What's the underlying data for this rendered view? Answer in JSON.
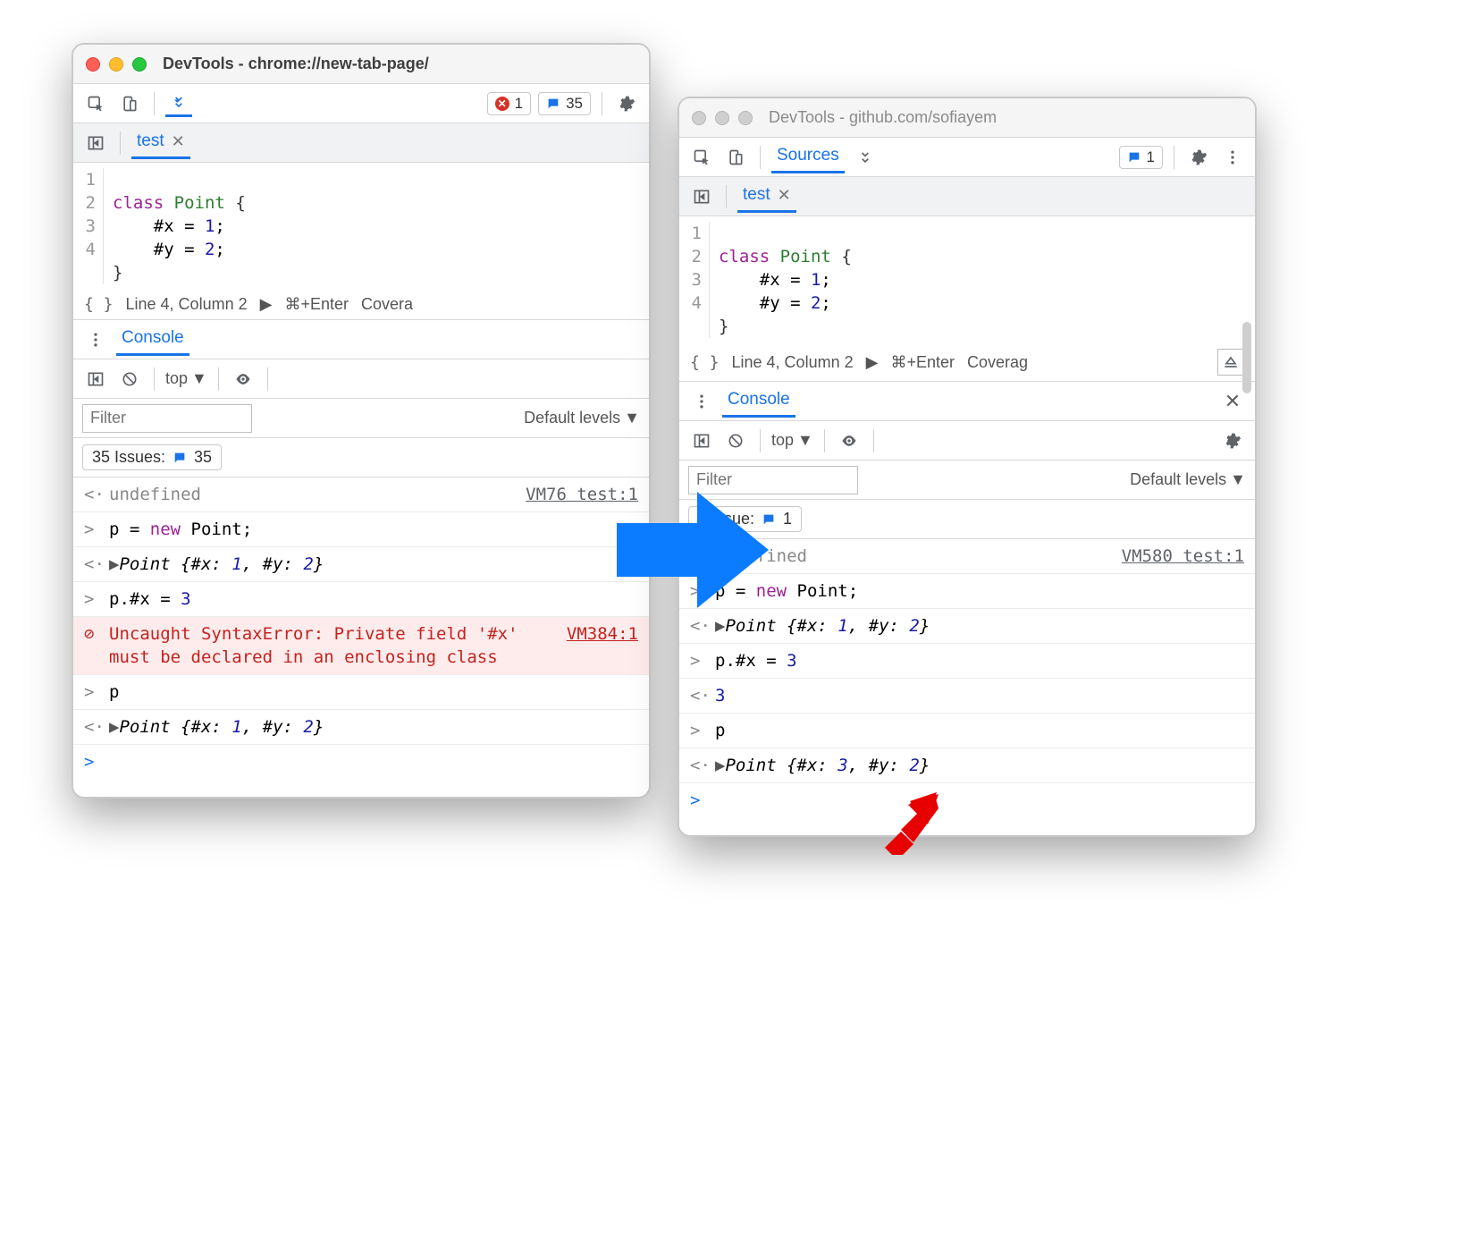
{
  "left": {
    "title": "DevTools - chrome://new-tab-page/",
    "traffic_active": true,
    "toolbar": {
      "errors": "1",
      "issues": "35"
    },
    "file_tab": {
      "name": "test"
    },
    "code": {
      "lines": [
        "1",
        "2",
        "3",
        "4"
      ],
      "l1_kw": "class",
      "l1_type": "Point",
      "l1_brace": "{",
      "l2": "    #x = ",
      "l2_num": "1",
      "l2_semi": ";",
      "l3": "    #y = ",
      "l3_num": "2",
      "l3_semi": ";",
      "l4": "}"
    },
    "status": {
      "pos": "Line 4, Column 2",
      "run": "⌘+Enter",
      "coverage": "Covera"
    },
    "drawer": {
      "tab": "Console"
    },
    "context": "top",
    "filter_placeholder": "Filter",
    "levels": "Default levels",
    "issues_label": "35 Issues:",
    "issues_badge": "35",
    "console": {
      "r0": {
        "text": "undefined",
        "src": "VM76 test:1"
      },
      "r1_a": "p = ",
      "r1_b": "new",
      "r1_c": " Point;",
      "r2_pre": "Point {#x: ",
      "r2_n1": "1",
      "r2_mid": ", #y: ",
      "r2_n2": "2",
      "r2_post": "}",
      "r3_a": "p.#x = ",
      "r3_n": "3",
      "err": {
        "text": "Uncaught SyntaxError: Private field '#x' must be declared in an enclosing class",
        "src": "VM384:1"
      },
      "r5": "p",
      "r6_pre": "Point {#x: ",
      "r6_n1": "1",
      "r6_mid": ", #y: ",
      "r6_n2": "2",
      "r6_post": "}"
    }
  },
  "right": {
    "title": "DevTools - github.com/sofiayem",
    "tabs": {
      "sources": "Sources"
    },
    "toolbar": {
      "issues": "1"
    },
    "file_tab": {
      "name": "test"
    },
    "code": {
      "lines": [
        "1",
        "2",
        "3",
        "4"
      ],
      "l1_kw": "class",
      "l1_type": "Point",
      "l1_brace": "{",
      "l2": "    #x = ",
      "l2_num": "1",
      "l2_semi": ";",
      "l3": "    #y = ",
      "l3_num": "2",
      "l3_semi": ";",
      "l4": "}"
    },
    "status": {
      "pos": "Line 4, Column 2",
      "run": "⌘+Enter",
      "coverage": "Coverag"
    },
    "drawer": {
      "tab": "Console"
    },
    "context": "top",
    "filter_placeholder": "Filter",
    "levels": "Default levels",
    "issues_label": "1 Issue:",
    "issues_badge": "1",
    "console": {
      "r0": {
        "text": "undefined",
        "src": "VM580 test:1"
      },
      "r1_a": "p = ",
      "r1_b": "new",
      "r1_c": " Point;",
      "r2_pre": "Point {#x: ",
      "r2_n1": "1",
      "r2_mid": ", #y: ",
      "r2_n2": "2",
      "r2_post": "}",
      "r3_a": "p.#x = ",
      "r3_n": "3",
      "r4": "3",
      "r5": "p",
      "r6_pre": "Point {#x: ",
      "r6_n1": "3",
      "r6_mid": ", #y: ",
      "r6_n2": "2",
      "r6_post": "}"
    }
  }
}
